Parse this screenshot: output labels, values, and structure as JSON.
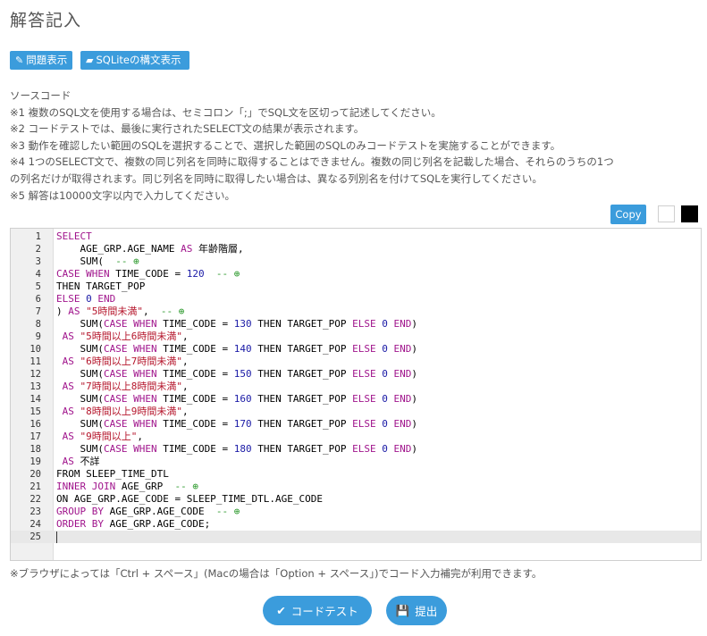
{
  "page": {
    "title": "解答記入"
  },
  "toolbar": {
    "problem_label": "問題表示",
    "syntax_label": "SQLiteの構文表示"
  },
  "notes": {
    "heading": "ソースコード",
    "items": [
      "※1 複数のSQL文を使用する場合は、セミコロン「;」でSQL文を区切って記述してください。",
      "※2 コードテストでは、最後に実行されたSELECT文の結果が表示されます。",
      "※3 動作を確認したい範囲のSQLを選択することで、選択した範囲のSQLのみコードテストを実施することができます。",
      "※4 1つのSELECT文で、複数の同じ列名を同時に取得することはできません。複数の同じ列名を記載した場合、それらのうちの1つ",
      "の列名だけが取得されます。同じ列名を同時に取得したい場合は、異なる列別名を付けてSQLを実行してください。",
      "※5 解答は10000文字以内で入力してください。"
    ]
  },
  "editor": {
    "copy_label": "Copy",
    "theme_colors": {
      "light": "#ffffff",
      "dark": "#000000"
    },
    "active_line": 25,
    "lines": [
      "SELECT",
      "    AGE_GRP.AGE_NAME AS 年齢階層,",
      "    SUM(  -- ⊕",
      "CASE WHEN TIME_CODE = 120  -- ⊕",
      "THEN TARGET_POP",
      "ELSE 0 END",
      ") AS \"5時間未満\",  -- ⊕",
      "    SUM(CASE WHEN TIME_CODE = 130 THEN TARGET_POP ELSE 0 END)",
      " AS \"5時間以上6時間未満\",",
      "    SUM(CASE WHEN TIME_CODE = 140 THEN TARGET_POP ELSE 0 END)",
      " AS \"6時間以上7時間未満\",",
      "    SUM(CASE WHEN TIME_CODE = 150 THEN TARGET_POP ELSE 0 END)",
      " AS \"7時間以上8時間未満\",",
      "    SUM(CASE WHEN TIME_CODE = 160 THEN TARGET_POP ELSE 0 END)",
      " AS \"8時間以上9時間未満\",",
      "    SUM(CASE WHEN TIME_CODE = 170 THEN TARGET_POP ELSE 0 END)",
      " AS \"9時間以上\",",
      "    SUM(CASE WHEN TIME_CODE = 180 THEN TARGET_POP ELSE 0 END)",
      " AS 不詳",
      "FROM SLEEP_TIME_DTL",
      "INNER JOIN AGE_GRP  -- ⊕",
      "ON AGE_GRP.AGE_CODE = SLEEP_TIME_DTL.AGE_CODE",
      "GROUP BY AGE_GRP.AGE_CODE  -- ⊕",
      "ORDER BY AGE_GRP.AGE_CODE;",
      ""
    ]
  },
  "hint": "※ブラウザによっては「Ctrl + スペース」(Macの場合は「Option + スペース」)でコード入力補完が利用できます。",
  "actions": {
    "test_label": "コードテスト",
    "submit_label": "提出"
  }
}
